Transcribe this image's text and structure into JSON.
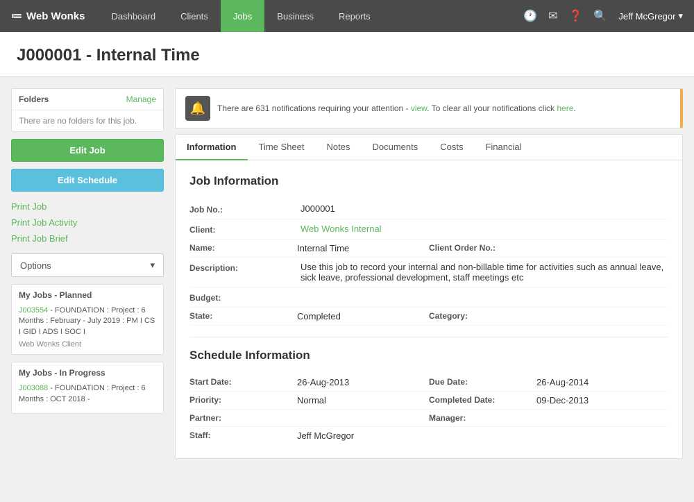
{
  "app": {
    "brand": "Web Wonks",
    "brand_icon": "≔",
    "user": "Jeff McGregor",
    "user_caret": "▾"
  },
  "nav": {
    "items": [
      {
        "label": "Dashboard",
        "active": false
      },
      {
        "label": "Clients",
        "active": false
      },
      {
        "label": "Jobs",
        "active": true
      },
      {
        "label": "Business",
        "active": false
      },
      {
        "label": "Reports",
        "active": false
      }
    ]
  },
  "page": {
    "title": "J000001 - Internal Time"
  },
  "sidebar": {
    "folders_label": "Folders",
    "folders_manage": "Manage",
    "folders_empty": "There are no folders for this job.",
    "edit_job_label": "Edit Job",
    "edit_schedule_label": "Edit Schedule",
    "print_job_label": "Print Job",
    "print_job_activity_label": "Print Job Activity",
    "print_job_brief_label": "Print Job Brief",
    "options_label": "Options",
    "my_jobs_planned_label": "My Jobs - Planned",
    "job1_link": "J003554",
    "job1_desc": " - FOUNDATION : Project : 6 Months : February - July 2019 : PM I CS I GID I ADS I SOC I",
    "job1_client": "Web Wonks Client",
    "my_jobs_inprogress_label": "My Jobs - In Progress",
    "job2_link": "J003088",
    "job2_desc": " - FOUNDATION : Project : 6 Months : OCT 2018 -"
  },
  "notification": {
    "text": "There are 631 notifications requiring your attention - ",
    "view_link": "view",
    "middle_text": ". To clear all your notifications click ",
    "here_link": "here",
    "end_text": "."
  },
  "tabs": [
    {
      "label": "Information",
      "active": true
    },
    {
      "label": "Time Sheet",
      "active": false
    },
    {
      "label": "Notes",
      "active": false
    },
    {
      "label": "Documents",
      "active": false
    },
    {
      "label": "Costs",
      "active": false
    },
    {
      "label": "Financial",
      "active": false
    }
  ],
  "job_info": {
    "section_title": "Job Information",
    "job_no_label": "Job No.:",
    "job_no_value": "J000001",
    "client_label": "Client:",
    "client_value": "Web Wonks Internal",
    "name_label": "Name:",
    "name_value": "Internal Time",
    "client_order_label": "Client Order No.:",
    "client_order_value": "",
    "description_label": "Description:",
    "description_value": "Use this job to record your internal and non-billable time for activities such as annual leave, sick leave, professional development, staff meetings etc",
    "budget_label": "Budget:",
    "budget_value": "",
    "state_label": "State:",
    "state_value": "Completed",
    "category_label": "Category:",
    "category_value": ""
  },
  "schedule_info": {
    "section_title": "Schedule Information",
    "start_date_label": "Start Date:",
    "start_date_value": "26-Aug-2013",
    "due_date_label": "Due Date:",
    "due_date_value": "26-Aug-2014",
    "priority_label": "Priority:",
    "priority_value": "Normal",
    "completed_date_label": "Completed Date:",
    "completed_date_value": "09-Dec-2013",
    "partner_label": "Partner:",
    "partner_value": "",
    "manager_label": "Manager:",
    "manager_value": "",
    "staff_label": "Staff:",
    "staff_value": "Jeff McGregor"
  }
}
